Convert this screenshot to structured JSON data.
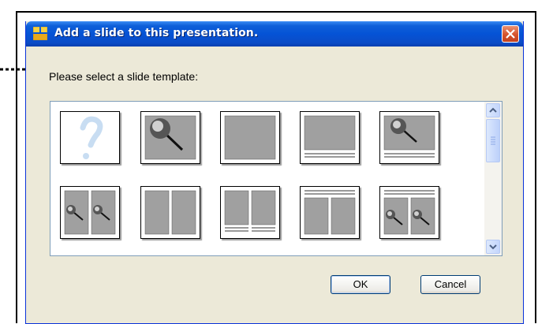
{
  "dialog": {
    "title": "Add a slide to this presentation.",
    "prompt": "Please select a slide template:",
    "ok_label": "OK",
    "cancel_label": "Cancel"
  },
  "templates": [
    {
      "name": "blank-template",
      "icon": "question-mark-icon"
    },
    {
      "name": "single-image-template",
      "icon": "magnifier-icon"
    },
    {
      "name": "single-block-template",
      "icon": "block-icon"
    },
    {
      "name": "block-with-caption-template",
      "icon": "block-caption-icon"
    },
    {
      "name": "image-with-caption-template",
      "icon": "magnifier-caption-icon"
    },
    {
      "name": "two-images-template",
      "icon": "two-magnifier-icon"
    },
    {
      "name": "two-blocks-template",
      "icon": "two-block-icon"
    },
    {
      "name": "two-blocks-caption-template",
      "icon": "two-block-caption-icon"
    },
    {
      "name": "header-two-blocks-template",
      "icon": "header-two-block-icon"
    },
    {
      "name": "header-two-images-template",
      "icon": "header-two-magnifier-icon"
    }
  ],
  "colors": {
    "titlebar": "#0553d6",
    "dialog_bg": "#ece9d8",
    "thumb_fill": "#a0a0a0"
  }
}
